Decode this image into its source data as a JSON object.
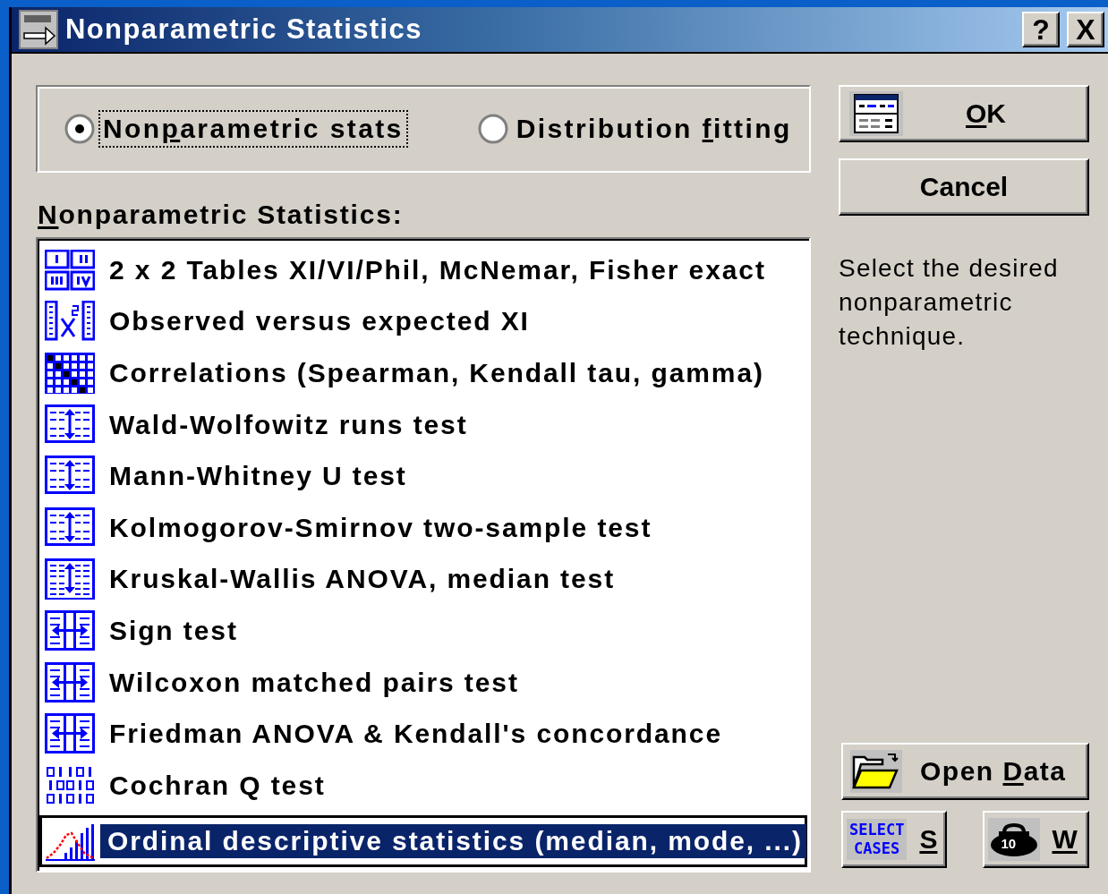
{
  "window": {
    "title": "Nonparametric Statistics",
    "help_button": "?",
    "close_button": "X"
  },
  "mode_options": [
    {
      "label_parts": [
        {
          "text": "Non",
          "underlined": false
        },
        {
          "text": "p",
          "underlined": true
        },
        {
          "text": "arametric stats",
          "underlined": false
        }
      ],
      "selected": true
    },
    {
      "label_parts": [
        {
          "text": "Distribution ",
          "underlined": false
        },
        {
          "text": "f",
          "underlined": true
        },
        {
          "text": "itting",
          "underlined": false
        }
      ],
      "selected": false
    }
  ],
  "list_label_parts": [
    {
      "text": "N",
      "underlined": true
    },
    {
      "text": "onparametric Statistics:",
      "underlined": false
    }
  ],
  "items": [
    {
      "label": "2 x 2 Tables XI/VI/Phil, McNemar, Fisher exact",
      "kind": "tables",
      "selected": false
    },
    {
      "label": "Observed versus expected XI",
      "kind": "observed",
      "selected": false
    },
    {
      "label": "Correlations (Spearman, Kendall tau, gamma)",
      "kind": "correlation",
      "selected": false
    },
    {
      "label": "Wald-Wolfowitz runs test",
      "kind": "groups",
      "selected": false
    },
    {
      "label": "Mann-Whitney U test",
      "kind": "groups",
      "selected": false
    },
    {
      "label": "Kolmogorov-Smirnov two-sample test",
      "kind": "groups",
      "selected": false
    },
    {
      "label": "Kruskal-Wallis ANOVA, median test",
      "kind": "multigroups",
      "selected": false
    },
    {
      "label": "Sign test",
      "kind": "paired",
      "selected": false
    },
    {
      "label": "Wilcoxon matched pairs test",
      "kind": "paired",
      "selected": false
    },
    {
      "label": "Friedman ANOVA & Kendall's concordance",
      "kind": "multipaired",
      "selected": false
    },
    {
      "label": "Cochran Q test",
      "kind": "binary",
      "selected": false
    },
    {
      "label": "Ordinal descriptive statistics (median, mode, ...)",
      "kind": "ordinal",
      "selected": true
    }
  ],
  "ok_button": {
    "label_parts": [
      {
        "text": "O",
        "underlined": true
      },
      {
        "text": "K",
        "underlined": false
      }
    ]
  },
  "cancel_button": {
    "label": "Cancel"
  },
  "description": "Select the desired nonparametric technique.",
  "open_data_button": {
    "label_parts": [
      {
        "text": "Open ",
        "underlined": false
      },
      {
        "text": "D",
        "underlined": true
      },
      {
        "text": "ata",
        "underlined": false
      }
    ]
  },
  "select_cases_button": {
    "icon_lines": [
      "SELECT",
      "CASES"
    ],
    "key": "S"
  },
  "weight_button": {
    "icon_text": "10",
    "key": "W"
  }
}
